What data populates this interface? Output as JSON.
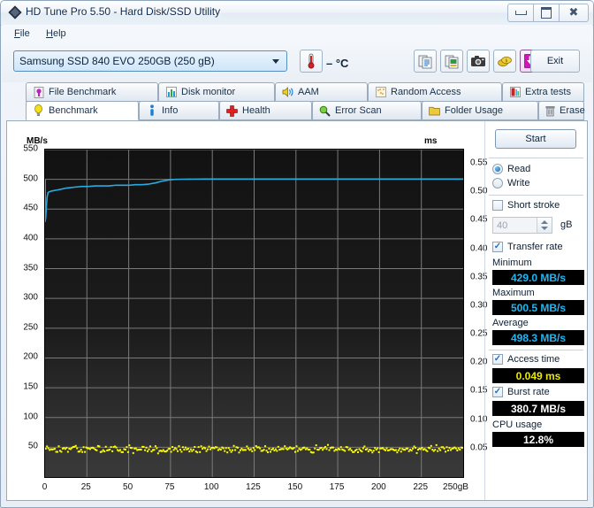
{
  "window": {
    "title": "HD Tune Pro 5.50 - Hard Disk/SSD Utility",
    "minimize_label": "Minimize",
    "maximize_label": "Maximize",
    "close_label": "Close"
  },
  "menu": {
    "items": [
      {
        "label": "File",
        "accel": "F"
      },
      {
        "label": "Help",
        "accel": "H"
      }
    ]
  },
  "toolbar": {
    "drive_selected": "Samsung SSD 840 EVO 250GB (250 gB)",
    "temperature": "– °C",
    "buttons": [
      {
        "name": "temperature-button",
        "icon": "thermometer-icon"
      },
      {
        "name": "copy-text-button",
        "icon": "copy-text-icon"
      },
      {
        "name": "copy-image-button",
        "icon": "copy-image-icon"
      },
      {
        "name": "screenshot-button",
        "icon": "camera-icon"
      },
      {
        "name": "donate-button",
        "icon": "coins-icon"
      },
      {
        "name": "download-button",
        "icon": "down-arrow-icon"
      }
    ],
    "exit_label": "Exit"
  },
  "tabs": {
    "top_row": [
      {
        "label": "File Benchmark",
        "icon": "file-benchmark-icon",
        "active": false
      },
      {
        "label": "Disk monitor",
        "icon": "bar-chart-icon",
        "active": false
      },
      {
        "label": "AAM",
        "icon": "speaker-icon",
        "active": false
      },
      {
        "label": "Random Access",
        "icon": "random-access-icon",
        "active": false
      },
      {
        "label": "Extra tests",
        "icon": "extra-tests-icon",
        "active": false
      }
    ],
    "bottom_row": [
      {
        "label": "Benchmark",
        "icon": "bulb-icon",
        "active": true
      },
      {
        "label": "Info",
        "icon": "info-icon",
        "active": false
      },
      {
        "label": "Health",
        "icon": "health-cross-icon",
        "active": false
      },
      {
        "label": "Error Scan",
        "icon": "magnifier-icon",
        "active": false
      },
      {
        "label": "Folder Usage",
        "icon": "folder-icon",
        "active": false
      },
      {
        "label": "Erase",
        "icon": "trash-icon",
        "active": false
      }
    ]
  },
  "controls": {
    "start_label": "Start",
    "mode": {
      "read_label": "Read",
      "write_label": "Write",
      "selected": "Read"
    },
    "short_stroke": {
      "label": "Short stroke",
      "checked": false,
      "value": "40",
      "unit": "gB"
    },
    "transfer_rate": {
      "label": "Transfer rate",
      "checked": true
    },
    "stats": [
      {
        "name": "minimum",
        "label": "Minimum",
        "value": "429.0 MB/s",
        "color": "cyan"
      },
      {
        "name": "maximum",
        "label": "Maximum",
        "value": "500.5 MB/s",
        "color": "cyan"
      },
      {
        "name": "average",
        "label": "Average",
        "value": "498.3 MB/s",
        "color": "cyan"
      }
    ],
    "access_time": {
      "label": "Access time",
      "checked": true,
      "value": "0.049 ms",
      "color": "yellow"
    },
    "burst_rate": {
      "label": "Burst rate",
      "checked": true,
      "value": "380.7 MB/s",
      "color": "white"
    },
    "cpu_usage": {
      "label": "CPU usage",
      "value": "12.8%",
      "color": "white"
    }
  },
  "chart_data": {
    "type": "line",
    "title": "",
    "ylabel": "MB/s",
    "ylabel_right": "ms",
    "xlabel": "gB",
    "xlim": [
      0,
      250
    ],
    "ylim": [
      0,
      550
    ],
    "ylim_right": [
      0,
      0.575
    ],
    "grid": true,
    "background": "#1a1a1a",
    "gridcolor": "#7a7a7a",
    "yticks": [
      0,
      50,
      100,
      150,
      200,
      250,
      300,
      350,
      400,
      450,
      500,
      550
    ],
    "ytick_labels": [
      "",
      "50",
      "100",
      "150",
      "200",
      "250",
      "300",
      "350",
      "400",
      "450",
      "500",
      "550"
    ],
    "yticks_right": [
      0.05,
      0.1,
      0.15,
      0.2,
      0.25,
      0.3,
      0.35,
      0.4,
      0.45,
      0.5,
      0.55
    ],
    "ytick_labels_right": [
      "0.05",
      "0.10",
      "0.15",
      "0.20",
      "0.25",
      "0.30",
      "0.35",
      "0.40",
      "0.45",
      "0.50",
      "0.55"
    ],
    "xticks": [
      0,
      25,
      50,
      75,
      100,
      125,
      150,
      175,
      200,
      225,
      250
    ],
    "xtick_labels": [
      "0",
      "25",
      "50",
      "75",
      "100",
      "125",
      "150",
      "175",
      "200",
      "225",
      "250gB"
    ],
    "series": [
      {
        "name": "Transfer rate",
        "color": "#29ABE2",
        "axis": "left",
        "x": [
          0.0,
          0.4,
          0.8,
          1.2,
          1.8,
          2.5,
          3.5,
          5.0,
          7.0,
          9.0,
          12.0,
          15.0,
          18.0,
          22.0,
          26.0,
          30.0,
          34.0,
          38.0,
          42.0,
          46.0,
          50.0,
          54.0,
          58.0,
          62.0,
          66.0,
          70.0,
          74.0,
          78.0,
          82.0,
          86.0,
          90.0,
          95.0,
          100.0,
          110.0,
          120.0,
          130.0,
          140.0,
          150.0,
          160.0,
          170.0,
          180.0,
          190.0,
          200.0,
          210.0,
          220.0,
          230.0,
          240.0,
          250.0
        ],
        "y": [
          429.0,
          436.0,
          455.0,
          470.0,
          478.0,
          479.0,
          480.0,
          481.0,
          482.0,
          483.0,
          485.0,
          486.0,
          487.0,
          488.0,
          488.0,
          489.0,
          489.0,
          489.0,
          490.0,
          490.0,
          490.0,
          491.0,
          491.0,
          492.0,
          494.0,
          497.0,
          499.0,
          500.0,
          500.2,
          500.3,
          500.4,
          500.5,
          500.5,
          500.5,
          500.5,
          500.5,
          500.5,
          500.5,
          500.5,
          500.5,
          500.5,
          500.5,
          500.5,
          500.5,
          500.5,
          500.5,
          500.5,
          500.5
        ]
      },
      {
        "name": "Access time",
        "color": "#FFFF00",
        "axis": "right",
        "marker": "dot",
        "mean": 0.049,
        "spread": 0.009,
        "point_count": 320
      }
    ]
  }
}
